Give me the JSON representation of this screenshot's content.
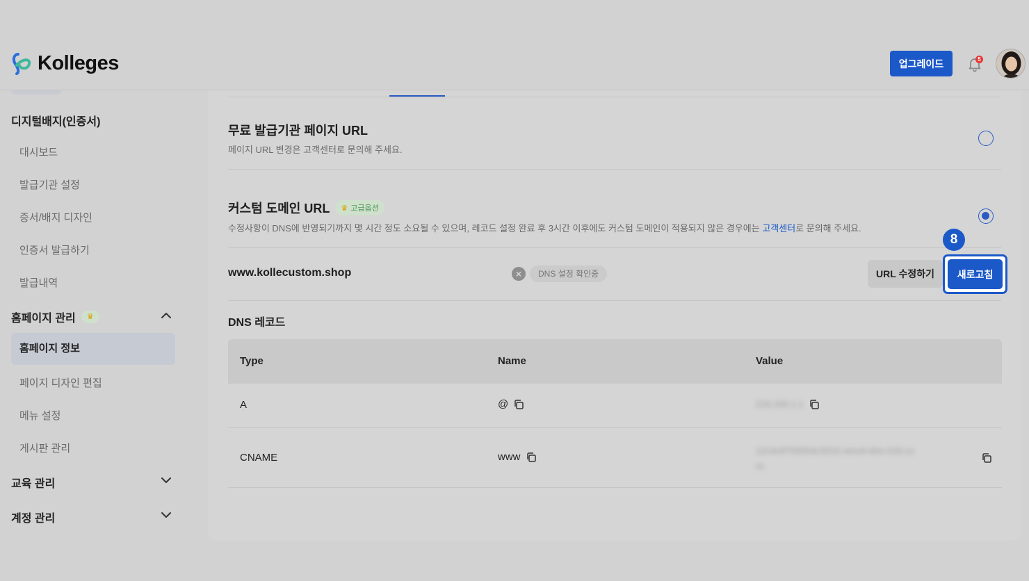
{
  "header": {
    "brand": "Kolleges",
    "upgrade_label": "업그레이드",
    "notification_count": "5"
  },
  "sidebar": {
    "section_badge": {
      "label": "디지털배지(인증서)"
    },
    "badge_items": [
      "대시보드",
      "발급기관 설정",
      "증서/배지 디자인",
      "인증서 발급하기",
      "발급내역"
    ],
    "section_homepage": {
      "label": "홈페이지 관리"
    },
    "homepage_items": [
      "홈페이지 정보",
      "페이지 디자인 편집",
      "메뉴 설정",
      "게시판 관리"
    ],
    "active_item": "홈페이지 정보",
    "section_education": {
      "label": "교육 관리"
    },
    "section_account": {
      "label": "계정 관리"
    }
  },
  "main": {
    "free_url": {
      "title": "무료 발급기관 페이지 URL",
      "desc": "페이지 URL 변경은 고객센터로 문의해 주세요.",
      "selected": false
    },
    "custom_url": {
      "title": "커스텀 도메인 URL",
      "tag": "고급옵션",
      "desc_before": "수정사항이 DNS에 반영되기까지 몇 시간 정도 소요될 수 있으며, 레코드 설정 완료 후 3시간 이후에도 커스텀 도메인이 적용되지 않은 경우에는 ",
      "desc_link": "고객센터",
      "desc_after": "로 문의해 주세요.",
      "selected": true
    },
    "domain": "www.kollecustom.shop",
    "dns_status": "DNS 설정 확인중",
    "url_edit_label": "URL 수정하기",
    "refresh_label": "새로고침",
    "step_number": "8",
    "dns_title": "DNS 레코드",
    "table": {
      "headers": [
        "Type",
        "Name",
        "Value"
      ],
      "rows": [
        {
          "type": "A",
          "name": "@",
          "value": "216.150.1.1"
        },
        {
          "type": "CNAME",
          "name": "www",
          "value": "12c4c8750054c3316.vercel-dns-016.co",
          "value_line2": "m."
        }
      ]
    }
  },
  "colors": {
    "primary": "#1b59c9",
    "background": "#d2d2d2",
    "tag_green": "#4c9a58",
    "crown_gold": "#d7a100",
    "badge_red": "#e53935"
  }
}
